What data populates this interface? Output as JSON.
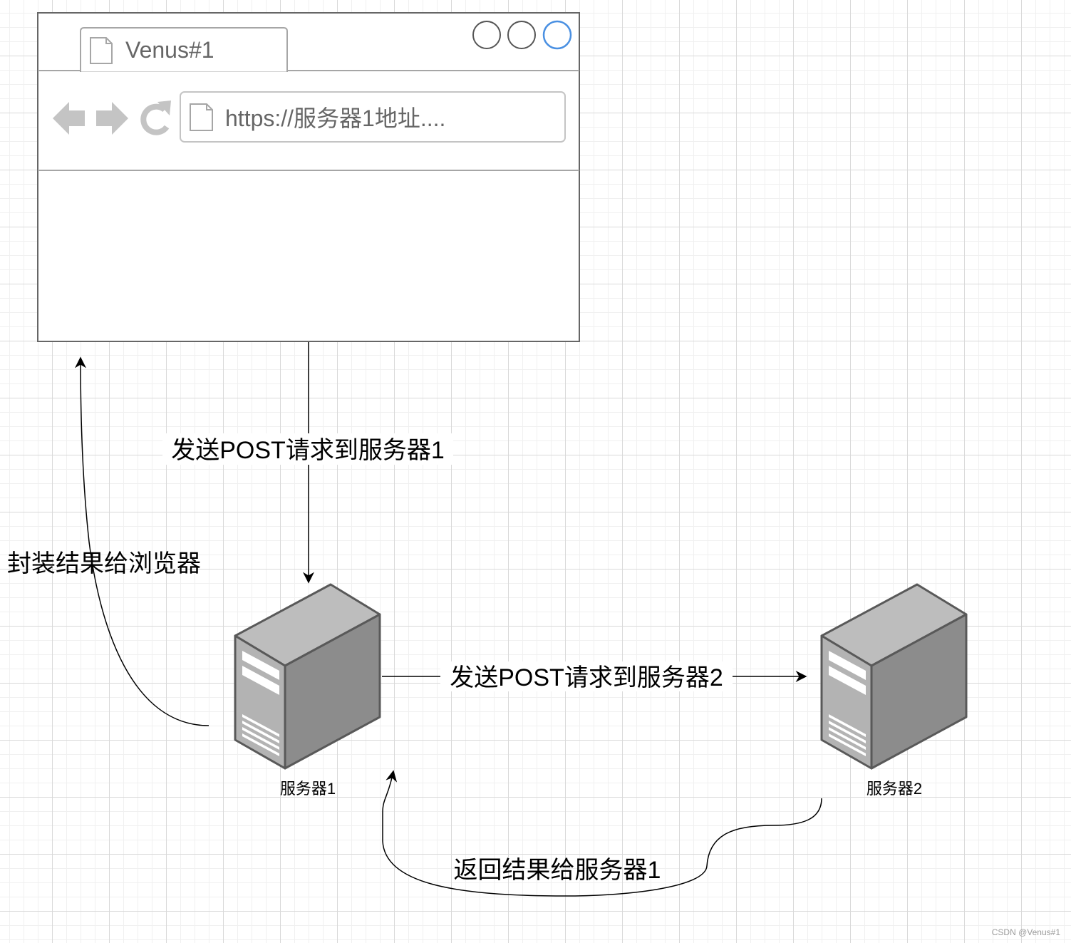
{
  "browser": {
    "tab_title": "Venus#1",
    "url": "https://服务器1地址....",
    "accent_color": "#4a90e2"
  },
  "servers": [
    {
      "label": "服务器1"
    },
    {
      "label": "服务器2"
    }
  ],
  "edges": {
    "browser_to_server1": "发送POST请求到服务器1",
    "server1_to_server2": "发送POST请求到服务器2",
    "server2_to_server1": "返回结果给服务器1",
    "server1_to_browser": "封装结果给浏览器"
  },
  "watermark": "CSDN @Venus#1",
  "icons": [
    "page-icon",
    "back-arrow-icon",
    "forward-arrow-icon",
    "refresh-icon",
    "server-icon"
  ]
}
